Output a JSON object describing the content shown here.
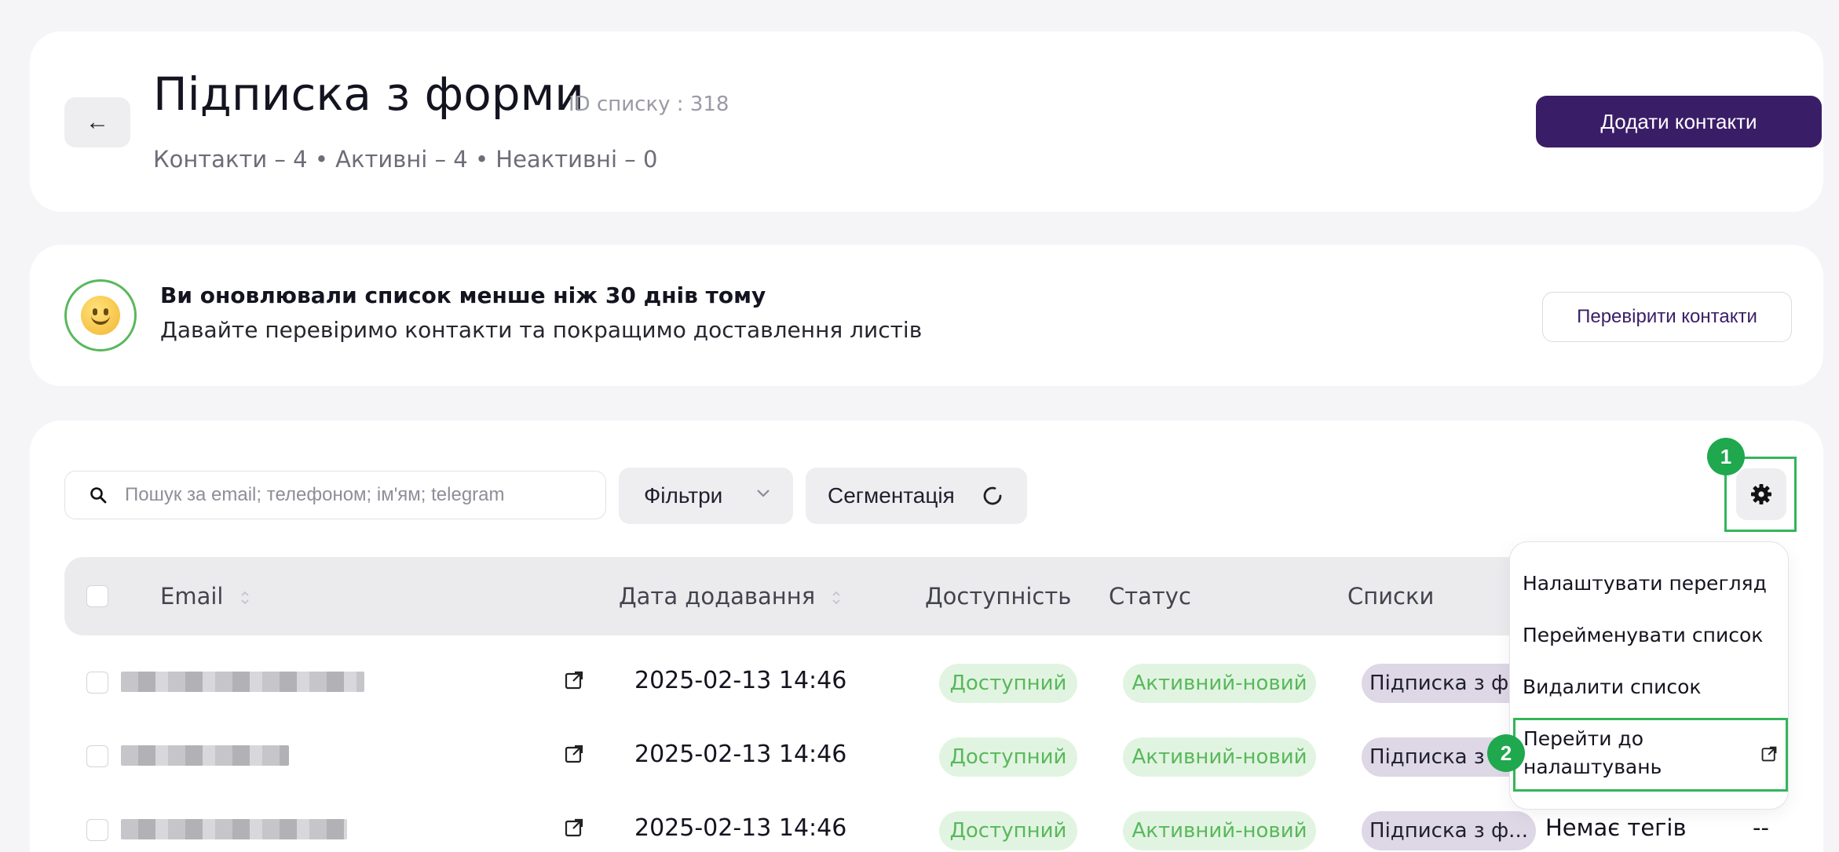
{
  "header": {
    "back_icon": "←",
    "title": "Підписка з форми",
    "list_id": "ID списку : 318",
    "stats": "Контакти – 4 • Активні – 4 • Неактивні – 0",
    "add_contacts_label": "Додати контакти"
  },
  "notice": {
    "title": "Ви оновлювали список менше ніж 30 днів тому",
    "subtitle": "Давайте перевіримо контакти та покращимо доставлення листів",
    "check_label": "Перевірити контакти"
  },
  "toolbar": {
    "search_placeholder": "Пошук за email; телефоном; ім'ям; telegram",
    "filters_label": "Фільтри",
    "segmentation_label": "Сегментація",
    "badge_1": "1",
    "badge_2": "2"
  },
  "table": {
    "columns": {
      "email": "Email",
      "date_added": "Дата додавання",
      "availability": "Доступність",
      "status": "Статус",
      "lists": "Списки"
    },
    "rows": [
      {
        "date": "2025-02-13 14:46",
        "availability": "Доступний",
        "status": "Активний-новий",
        "list": "Підписка з ф..."
      },
      {
        "date": "2025-02-13 14:46",
        "availability": "Доступний",
        "status": "Активний-новий",
        "list": "Підписка з ф..."
      },
      {
        "date": "2025-02-13 14:46",
        "availability": "Доступний",
        "status": "Активний-новий",
        "list": "Підписка з ф...",
        "tags": "Немає тегів",
        "extra": "--"
      }
    ]
  },
  "menu": {
    "items": [
      "Налаштувати перегляд",
      "Перейменувати список",
      "Видалити список",
      "Перейти до налаштувань"
    ]
  },
  "colors": {
    "primary": "#3a1d67",
    "highlight": "#34b55a",
    "badge": "#1fa84d",
    "available_bg": "#e1f4e1",
    "available_text": "#59b85b",
    "list_pill_bg": "#ddd7e6"
  }
}
